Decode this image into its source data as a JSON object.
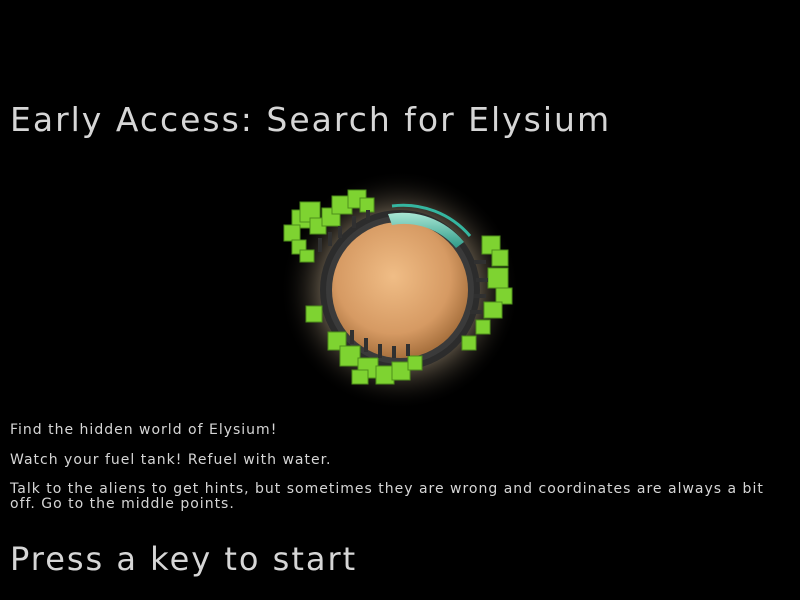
{
  "screen": {
    "title": "Early Access: Search for Elysium",
    "instructions": [
      "Find the hidden world of Elysium!",
      "Watch your fuel tank! Refuel with water.",
      "Talk to the aliens to get hints, but sometimes they are wrong and coordinates are always a bit off. Go to the middle points."
    ],
    "prompt": "Press a key to start"
  },
  "planet": {
    "icon": "planet-icon",
    "colors": {
      "surface": "#d8a06c",
      "trees": "#7ed331",
      "water": "#3bb39c",
      "glow": "#fff1da",
      "atmosphere_ring": "#3a3a3a"
    }
  }
}
